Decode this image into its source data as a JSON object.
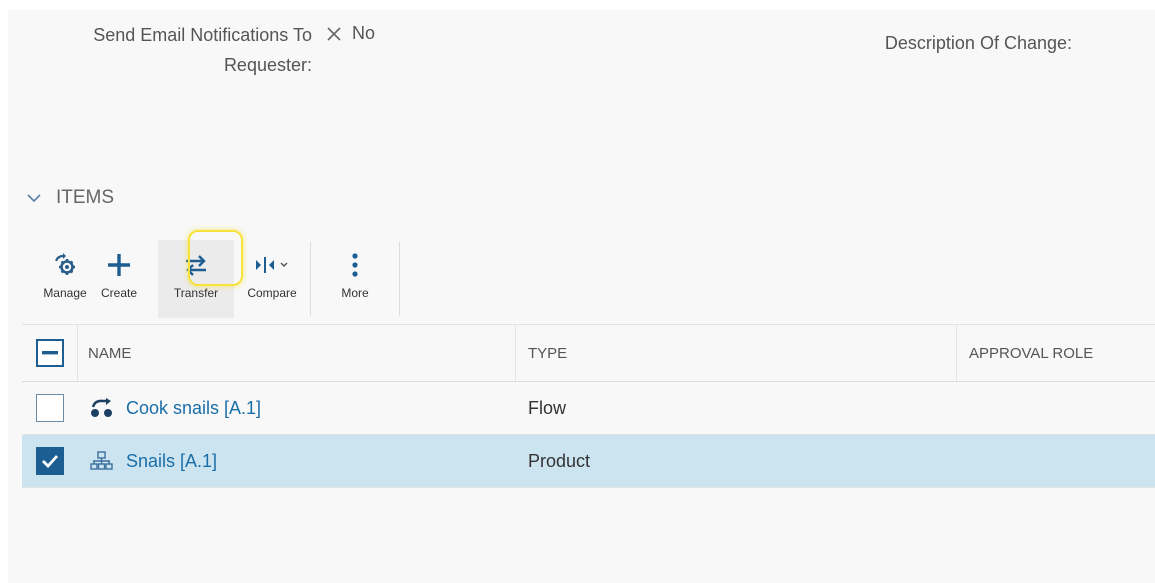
{
  "form": {
    "notify_label": "Send Email Notifications To Requester:",
    "notify_value": "No",
    "description_label": "Description Of Change:"
  },
  "items_section": {
    "title": "ITEMS"
  },
  "toolbar": {
    "manage": "Manage",
    "create": "Create",
    "transfer": "Transfer",
    "compare": "Compare",
    "more": "More"
  },
  "table": {
    "columns": [
      "NAME",
      "TYPE",
      "APPROVAL ROLE"
    ],
    "rows": [
      {
        "name": "Cook snails [A.1]",
        "type": "Flow",
        "approval_role": "",
        "selected": false,
        "icon": "flow-icon"
      },
      {
        "name": "Snails [A.1]",
        "type": "Product",
        "approval_role": "",
        "selected": true,
        "icon": "product-icon"
      }
    ]
  },
  "colors": {
    "accent": "#1c5d92",
    "link": "#1a6ea8",
    "selected_row": "#cce3f0",
    "highlight": "#f7e23a"
  }
}
